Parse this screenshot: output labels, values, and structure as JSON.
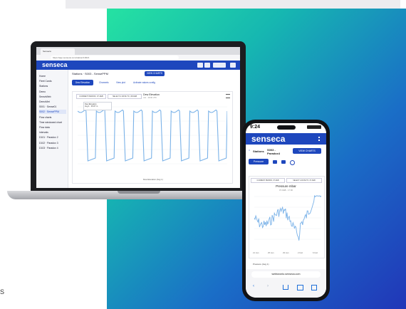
{
  "side_letter": "S",
  "laptop": {
    "tab_title": "Senseca",
    "url": "https://app.senseca.com/station/10021",
    "logo": "senseca",
    "sidebar": {
      "items": [
        {
          "label": "Home"
        },
        {
          "label": "Fleet Cards"
        },
        {
          "label": "Stations"
        },
        {
          "label": "Demo"
        },
        {
          "label": "SenseWeb"
        },
        {
          "label": "DemoMet"
        },
        {
          "label": "S001 · Sense01"
        },
        {
          "label": "S002 · SensePPM"
        },
        {
          "label": "Flow charts"
        },
        {
          "label": "Time windowed chart"
        },
        {
          "label": "Flow data"
        },
        {
          "label": "Intervals"
        },
        {
          "label": "D101 · Paradox 2"
        },
        {
          "label": "D102 · Paradox 3"
        },
        {
          "label": "D103 · Paradox 4"
        }
      ]
    },
    "header_title": "Stations · S003 - SensePPM",
    "view_charts_label": "VIEW CHARTS",
    "sensor_button": "Dew Elevation",
    "tab_channels": "Channels",
    "tab_view_plot": "View plot",
    "tab_activate": "Activate values config",
    "date_from": "CURRENT PERIOD, 07-FEB",
    "date_to": "SELECT A DATE TO, 08-FEB",
    "chart_title": "Dew Elevation",
    "chart_subtitle": "m/s · 10:00 UTC",
    "tooltip_line1": "Dew Elevation",
    "tooltip_line2": "Avg 1 · 45.67 m",
    "x_axis_label": "Dew Elevation (Avg 1)"
  },
  "phone": {
    "time": "9:24",
    "logo": "senseca",
    "stations_label": "Stations",
    "station_name": "S003 - Paradox4",
    "view_charts_label": "VIEW CHARTS",
    "sensor_button": "Pressure",
    "date_from": "CURRENT PERIOD, 07-FEB",
    "date_to": "SELECT A DATE TO, 07-FEB",
    "chart_title": "Pressure mbar",
    "chart_subtitle": "07-FEB · 17:00",
    "x_labels": [
      "21 Jan",
      "25 Jan",
      "29 Jan",
      "2 Feb",
      "6 Feb"
    ],
    "legend": "Pressure (Avg 1)",
    "address": "webtoronto.senseca.com"
  },
  "colors": {
    "brand_blue": "#1e47bd",
    "grad_start": "#25e2a2",
    "grad_end": "#2136b8",
    "line_blue": "#7ab2e8"
  }
}
